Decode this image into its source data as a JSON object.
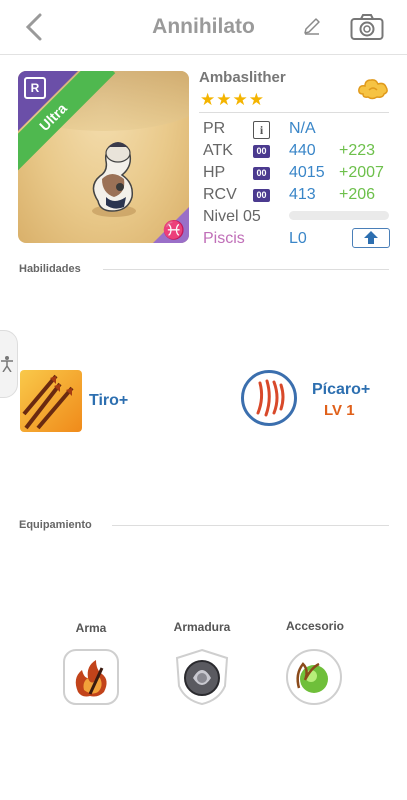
{
  "header": {
    "title": "Annihilato",
    "back_icon": "chevron-left-icon",
    "edit_icon": "pencil-icon",
    "camera_icon": "camera-icon"
  },
  "monster": {
    "rarity_label": "Ultra",
    "rarity_badge": "R",
    "zodiac_glyph": "♓",
    "name": "Ambaslither",
    "stars": "★★★★",
    "star_count": 4
  },
  "stats": {
    "pr": {
      "label": "PR",
      "value": "N/A"
    },
    "atk": {
      "label": "ATK",
      "badge": "00",
      "value": "440",
      "bonus": "+223"
    },
    "hp": {
      "label": "HP",
      "badge": "00",
      "value": "4015",
      "bonus": "+2007"
    },
    "rcv": {
      "label": "RCV",
      "badge": "00",
      "value": "413",
      "bonus": "+206"
    },
    "level": {
      "label": "Nivel 05",
      "progress": 0
    },
    "element": {
      "label": "Piscis",
      "value": "L0"
    }
  },
  "colors": {
    "accent_blue": "#3a86c8",
    "bonus_green": "#6dc04b",
    "piscis_pink": "#c06fb8",
    "ultra_green": "#4fb84f",
    "lv_orange": "#e0601a"
  },
  "skills": {
    "title": "Habilidades",
    "items": [
      {
        "label": "Tiro+",
        "icon": "arrows-icon"
      },
      {
        "label": "Pícaro+",
        "level": "LV 1",
        "icon": "claw-icon"
      }
    ]
  },
  "equipment": {
    "title": "Equipamiento",
    "slots": [
      {
        "label": "Arma",
        "icon": "flame-weapon-icon"
      },
      {
        "label": "Armadura",
        "icon": "shield-armor-icon"
      },
      {
        "label": "Accesorio",
        "icon": "green-orb-icon"
      }
    ]
  }
}
